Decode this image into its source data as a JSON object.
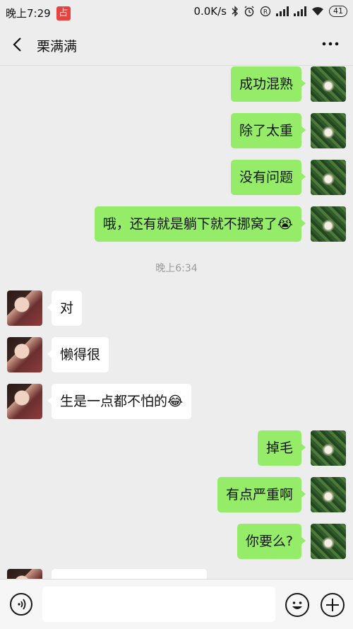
{
  "status_bar": {
    "time": "晚上7:29",
    "app_badge": "占",
    "speed": "0.0K/s",
    "battery": "41"
  },
  "header": {
    "title": "栗满满"
  },
  "messages": [
    {
      "side": "out",
      "text": "成功混熟"
    },
    {
      "side": "out",
      "text": "除了太重"
    },
    {
      "side": "out",
      "text": "没有问题"
    },
    {
      "side": "out",
      "text": "哦，还有就是躺下就不挪窝了😭"
    },
    {
      "timestamp": "晚上6:34"
    },
    {
      "side": "in",
      "text": "对"
    },
    {
      "side": "in",
      "text": "懒得很"
    },
    {
      "side": "in",
      "text": "生是一点都不怕的😂"
    },
    {
      "side": "out",
      "text": "掉毛"
    },
    {
      "side": "out",
      "text": "有点严重啊"
    },
    {
      "side": "out",
      "text": "你要么?"
    },
    {
      "side": "in",
      "text": ""
    }
  ],
  "input": {
    "value": ""
  },
  "colors": {
    "outgoing_bubble": "#95ec69",
    "incoming_bubble": "#ffffff",
    "background": "#ededed"
  }
}
